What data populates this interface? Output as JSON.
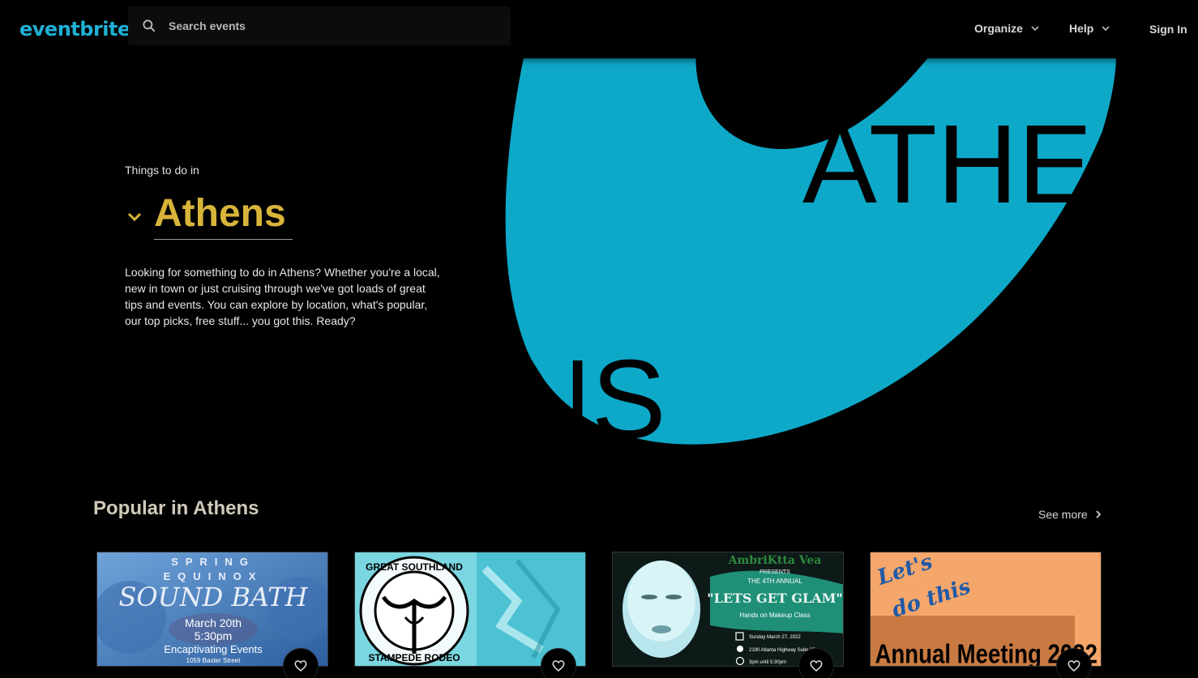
{
  "header": {
    "logo": "eventbrite",
    "search_placeholder": "Search events",
    "nav": [
      {
        "label": "Organize"
      },
      {
        "label": "Help"
      }
    ],
    "sign_in": "Sign In"
  },
  "hero": {
    "eyebrow": "Things to do in",
    "city": "Athens",
    "description": "Looking for something to do in Athens? Whether you're a local, new in town or just cruising through we've got loads of great tips and events. You can explore by location, what's popular, our top picks, free stuff... you got this. Ready?",
    "art_text_top": "ATHE",
    "art_text_bottom": "NS"
  },
  "popular": {
    "title": "Popular in Athens",
    "see_more": "See more",
    "cards": [
      {
        "lines": [
          "SPRING",
          "EQUINOX",
          "SOUND BATH",
          "March 20th",
          "5:30pm",
          "Encaptivating Events",
          "1059 Baxter Street"
        ]
      },
      {
        "lines": [
          "GREAT SOUTHLAND",
          "STAMPEDE RODEO"
        ]
      },
      {
        "lines": [
          "AmbriKtta Vea",
          "PRESENTS",
          "THE 4TH ANNUAL",
          "\"LETS GET GLAM\"",
          "Hands on Makeup Class",
          "Sunday March 27, 2022",
          "2190 Atlanta Highway Suite 25",
          "3pm until 5:30pm"
        ]
      },
      {
        "lines": [
          "Let's",
          "do this",
          "Annual Meeting 2022"
        ]
      }
    ]
  },
  "colors": {
    "accent": "#1fb1d6",
    "city": "#d8b43a",
    "hero_blob": "#0ea9c9"
  }
}
